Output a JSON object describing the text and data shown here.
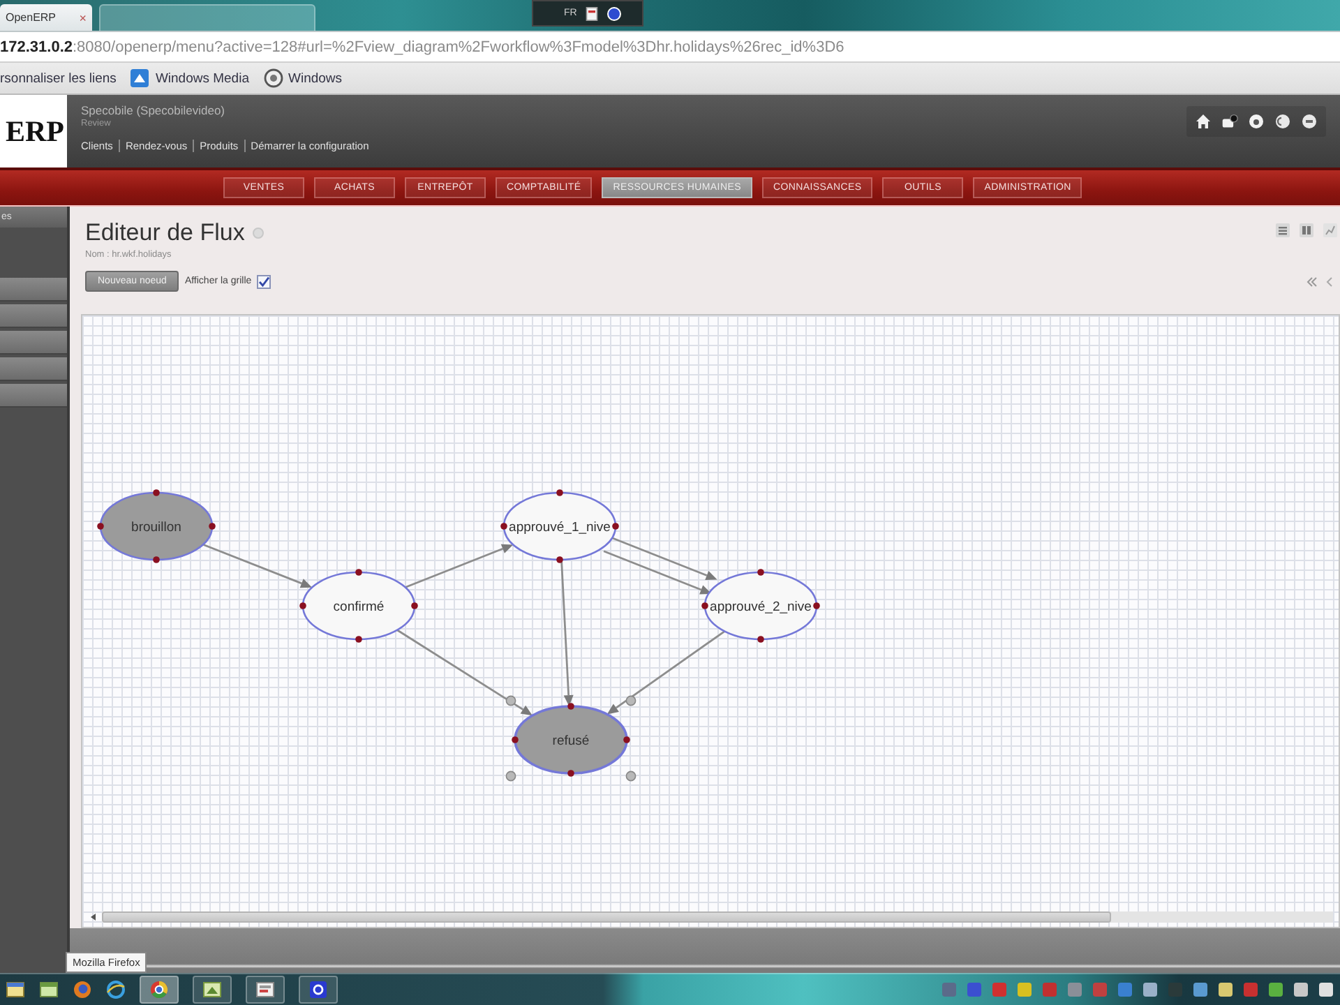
{
  "browser": {
    "tabs": [
      {
        "title": "OpenERP",
        "close": "×",
        "selected": true
      },
      {
        "selected": false
      }
    ],
    "language_bar": "FR",
    "url": "**172.31.0.2**:8080/openerp/menu?active=128#url=%2Fview_diagram%2Fworkflow%3Fmodel%3Dhr.holidays%26rec_id%3D6",
    "bookmarks": [
      {
        "label": "rsonnaliser les liens",
        "kind": "plain"
      },
      {
        "label": "Windows Media",
        "kind": "media"
      },
      {
        "label": "Windows",
        "kind": "web"
      }
    ]
  },
  "header": {
    "logo": "ERP",
    "company": "Specobile (Specobilevideo)",
    "user": "Review",
    "links": [
      "Clients",
      "Rendez-vous",
      "Produits",
      "Démarrer la configuration"
    ]
  },
  "menu": [
    {
      "label": "VENTES",
      "selected": false
    },
    {
      "label": "ACHATS",
      "selected": false
    },
    {
      "label": "ENTREPÔT",
      "selected": false
    },
    {
      "label": "COMPTABILITÉ",
      "selected": false
    },
    {
      "label": "RESSOURCES HUMAINES",
      "selected": true
    },
    {
      "label": "CONNAISSANCES",
      "selected": false
    },
    {
      "label": "OUTILS",
      "selected": false
    },
    {
      "label": "ADMINISTRATION",
      "selected": false
    }
  ],
  "sidebar": {
    "heading": "es"
  },
  "page": {
    "title": "Editeur de Flux",
    "breadcrumb": "Nom : hr.wkf.holidays",
    "new_node_button": "Nouveau noeud",
    "grid_toggle": {
      "label": "Afficher la grille",
      "checked": true
    }
  },
  "diagram": {
    "nodes": [
      {
        "label": "brouillon",
        "kind": "terminal",
        "selected": false
      },
      {
        "label": "confirmé",
        "kind": "activity",
        "selected": false
      },
      {
        "label": "approuvé_1_nive",
        "kind": "activity",
        "selected": false
      },
      {
        "label": "approuvé_2_nive",
        "kind": "activity",
        "selected": false
      },
      {
        "label": "refusé",
        "kind": "terminal",
        "selected": true
      }
    ]
  },
  "taskbar": {
    "tooltip": "Mozilla Firefox"
  }
}
